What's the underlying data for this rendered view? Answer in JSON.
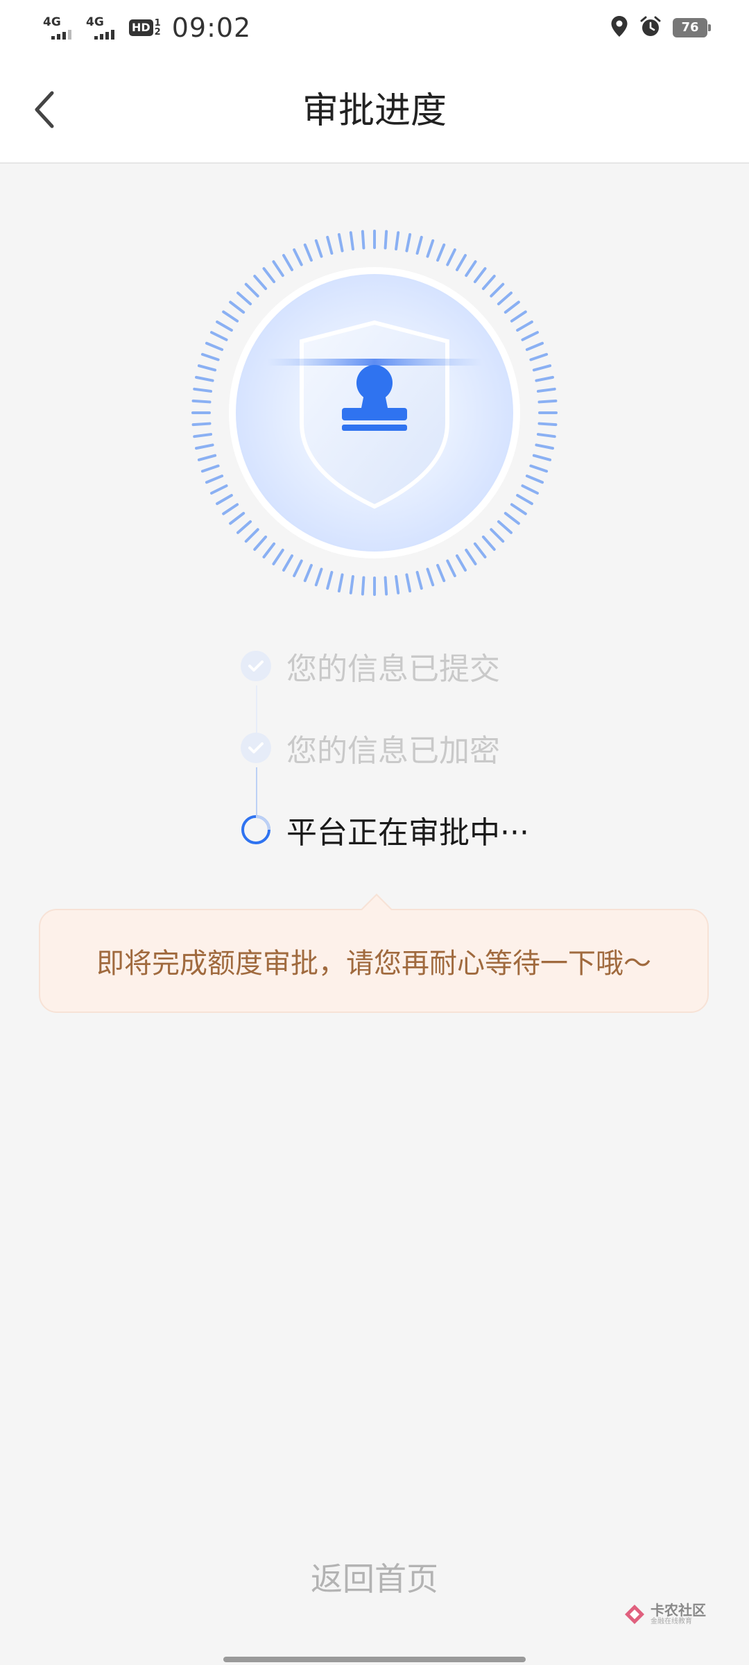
{
  "status_bar": {
    "network1": "4G",
    "network2": "4G",
    "hd_label": "HD",
    "hd_sub1": "1",
    "hd_sub2": "2",
    "time": "09:02",
    "battery": "76"
  },
  "header": {
    "title": "审批进度",
    "back_icon": "chevron-left-icon"
  },
  "steps": [
    {
      "label": "您的信息已提交",
      "status": "done"
    },
    {
      "label": "您的信息已加密",
      "status": "done"
    },
    {
      "label": "平台正在审批中···",
      "status": "in-progress"
    }
  ],
  "tip": {
    "text": "即将完成额度审批，请您再耐心等待一下哦～"
  },
  "footer": {
    "home_link": "返回首页"
  },
  "watermark": {
    "main": "卡农社区",
    "sub": "金融在线教育"
  },
  "colors": {
    "accent": "#2f73f0",
    "tip_bg": "#fdf1ea",
    "tip_text": "#a06a3e",
    "done_text": "#c9c9c9"
  }
}
